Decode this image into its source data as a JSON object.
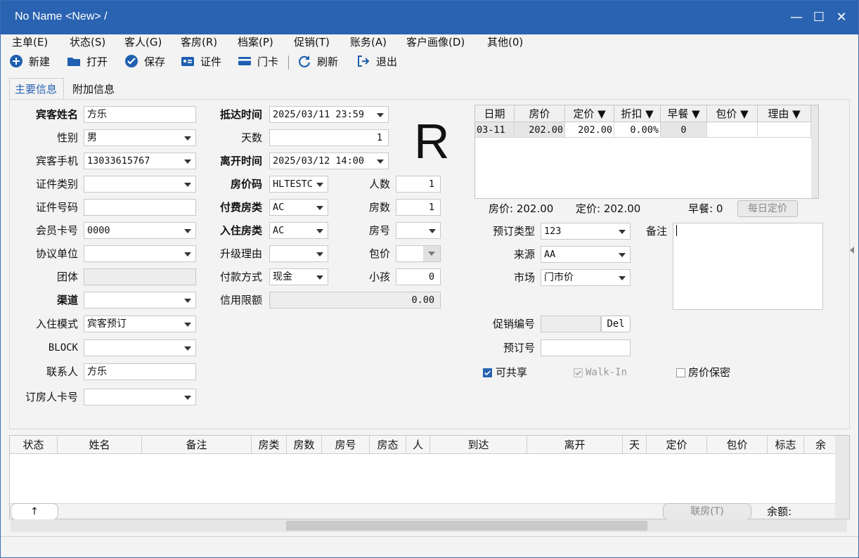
{
  "window": {
    "title": "No Name <New> /"
  },
  "menu": [
    "主单(E)",
    "状态(S)",
    "客人(G)",
    "客房(R)",
    "档案(P)",
    "促销(T)",
    "账务(A)",
    "客户画像(D)",
    "其他(0)"
  ],
  "toolbar": {
    "new": "新建",
    "open": "打开",
    "save": "保存",
    "id": "证件",
    "card": "门卡",
    "refresh": "刷新",
    "exit": "退出"
  },
  "tabs": {
    "main": "主要信息",
    "extra": "附加信息"
  },
  "form": {
    "guest_name_label": "宾客姓名",
    "guest_name": "方乐",
    "gender_label": "性别",
    "gender": "男",
    "phone_label": "宾客手机",
    "phone": "13033615767",
    "id_type_label": "证件类别",
    "id_type": "",
    "id_no_label": "证件号码",
    "id_no": "",
    "member_label": "会员卡号",
    "member": "0000",
    "company_label": "协议单位",
    "company": "",
    "group_label": "团体",
    "group": "",
    "channel_label": "渠道",
    "channel": "",
    "checkin_mode_label": "入住模式",
    "checkin_mode": "宾客预订",
    "block_label": "BLOCK",
    "block": "",
    "contact_label": "联系人",
    "contact": "方乐",
    "booker_card_label": "订房人卡号",
    "booker_card": "",
    "arrive_label": "抵达时间",
    "arrive": "2025/03/11 23:59",
    "days_label": "天数",
    "days": "1",
    "depart_label": "离开时间",
    "depart": "2025/03/12 14:00",
    "rate_code_label": "房价码",
    "rate_code": "HLTESTC",
    "pay_room_label": "付费房类",
    "pay_room": "AC",
    "stay_room_label": "入住房类",
    "stay_room": "AC",
    "upgrade_label": "升级理由",
    "upgrade": "",
    "pay_method_label": "付款方式",
    "pay_method": "现金",
    "credit_label": "信用限额",
    "credit": "0.00",
    "persons_label": "人数",
    "persons": "1",
    "rooms_label": "房数",
    "rooms": "1",
    "room_no_label": "房号",
    "room_no": "",
    "package_label": "包价",
    "package": "",
    "kids_label": "小孩",
    "kids": "0",
    "big_letter": "R",
    "booking_type_label": "预订类型",
    "booking_type": "123",
    "source_label": "来源",
    "source": "AA",
    "market_label": "市场",
    "market": "门市价",
    "remark_label": "备注",
    "remark": "",
    "promo_label": "促销编号",
    "promo": "",
    "del_btn": "Del",
    "booking_no_label": "预订号",
    "booking_no": "",
    "shareable": "可共享",
    "walkin": "Walk-In",
    "rate_secret": "房价保密"
  },
  "rate_grid": {
    "headers": [
      "日期",
      "房价",
      "定价 ▼",
      "折扣 ▼",
      "早餐 ▼",
      "包价 ▼",
      "理由 ▼"
    ],
    "row": [
      "03-11",
      "202.00",
      "202.00",
      "0.00%",
      "0",
      "",
      ""
    ],
    "summary_rate": "房价: 202.00",
    "summary_price": "定价: 202.00",
    "summary_breakfast": "早餐: 0",
    "daily_btn": "每日定价"
  },
  "room_list": {
    "headers": [
      "状态",
      "姓名",
      "备注",
      "房类",
      "房数",
      "房号",
      "房态",
      "人",
      "到达",
      "离开",
      "天",
      "定价",
      "包价",
      "标志",
      "余额"
    ],
    "up_btn": "↑",
    "link_btn": "联房(T)",
    "balance_label": "余额:"
  },
  "colors": {
    "titlebar": "#2a63b1",
    "accent": "#2a63b1"
  }
}
